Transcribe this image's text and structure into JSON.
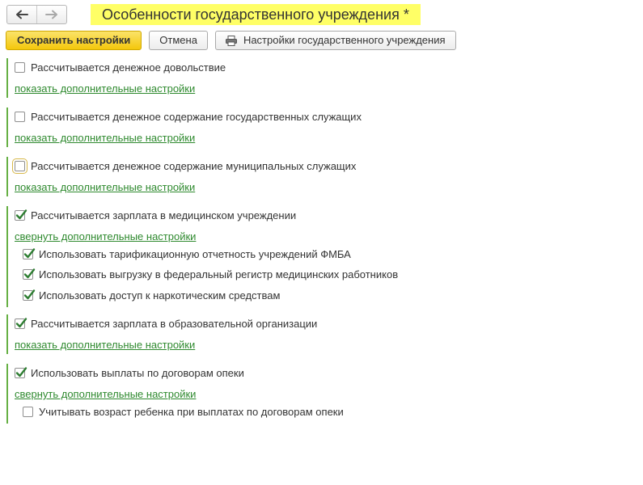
{
  "header": {
    "title": "Особенности государственного учреждения *"
  },
  "toolbar": {
    "save_label": "Сохранить настройки",
    "cancel_label": "Отмена",
    "settings_label": "Настройки государственного учреждения"
  },
  "sections": [
    {
      "label": "Рассчитывается денежное довольствие",
      "checked": false,
      "link": "показать дополнительные настройки"
    },
    {
      "label": "Рассчитывается денежное содержание государственных служащих",
      "checked": false,
      "link": "показать дополнительные настройки"
    },
    {
      "label": "Рассчитывается денежное содержание муниципальных служащих",
      "checked": false,
      "link": "показать дополнительные настройки"
    },
    {
      "label": "Рассчитывается зарплата в медицинском учреждении",
      "checked": true,
      "link": "свернуть дополнительные настройки",
      "sub_items": [
        {
          "label": "Использовать тарификационную отчетность учреждений ФМБА",
          "checked": true
        },
        {
          "label": "Использовать выгрузку в федеральный регистр медицинских работников",
          "checked": true
        },
        {
          "label": "Использовать доступ к наркотическим средствам",
          "checked": true
        }
      ]
    },
    {
      "label": "Рассчитывается зарплата в образовательной организации",
      "checked": true,
      "link": "показать дополнительные настройки"
    },
    {
      "label": "Использовать выплаты по договорам опеки",
      "checked": true,
      "link": "свернуть дополнительные настройки",
      "sub_items": [
        {
          "label": "Учитывать возраст ребенка при выплатах по договорам опеки",
          "checked": false
        }
      ]
    }
  ],
  "icons": {
    "back": "arrow-left-icon",
    "forward": "arrow-right-icon",
    "printer": "printer-icon",
    "check": "checkmark-icon"
  },
  "colors": {
    "title_highlight": "#ffff66",
    "primary_button": "#f4c70c",
    "link": "#2f8a2f",
    "group_bar": "#66b044",
    "checkmark": "#2e7d32"
  }
}
